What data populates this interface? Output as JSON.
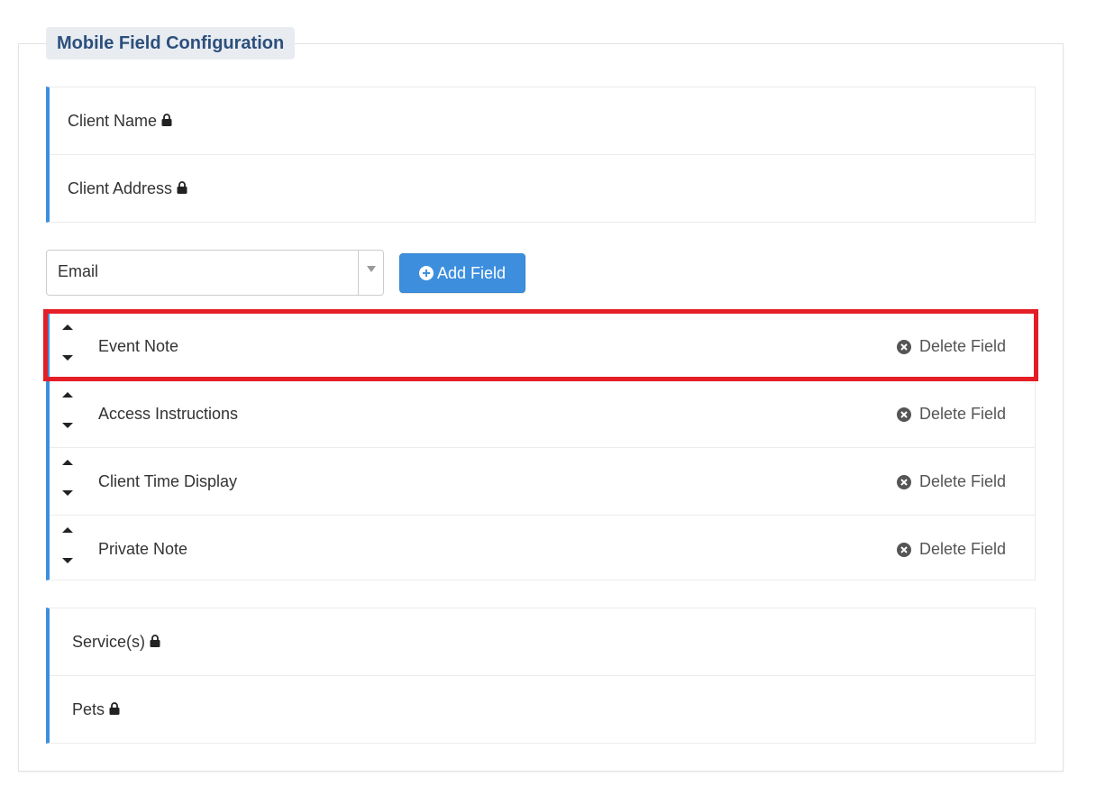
{
  "panel": {
    "title": "Mobile Field Configuration"
  },
  "locked_top": [
    {
      "label": "Client Name"
    },
    {
      "label": "Client Address"
    }
  ],
  "add_field": {
    "selected": "Email",
    "button_label": "Add Field"
  },
  "fields": [
    {
      "label": "Event Note",
      "delete_label": "Delete Field",
      "highlighted": true
    },
    {
      "label": "Access Instructions",
      "delete_label": "Delete Field"
    },
    {
      "label": "Client Time Display",
      "delete_label": "Delete Field"
    },
    {
      "label": "Private Note",
      "delete_label": "Delete Field"
    }
  ],
  "locked_bottom": [
    {
      "label": "Service(s)"
    },
    {
      "label": "Pets"
    }
  ],
  "colors": {
    "accent": "#3d8fde",
    "legend_bg": "#e8ecf1",
    "legend_text": "#2c4f7c",
    "highlight": "#e41e26"
  },
  "icons": {
    "lock": "lock-icon",
    "sort_up": "caret-up-icon",
    "sort_down": "caret-down-icon",
    "delete": "times-circle-icon",
    "add": "plus-circle-icon",
    "dropdown": "chevron-down-icon"
  }
}
